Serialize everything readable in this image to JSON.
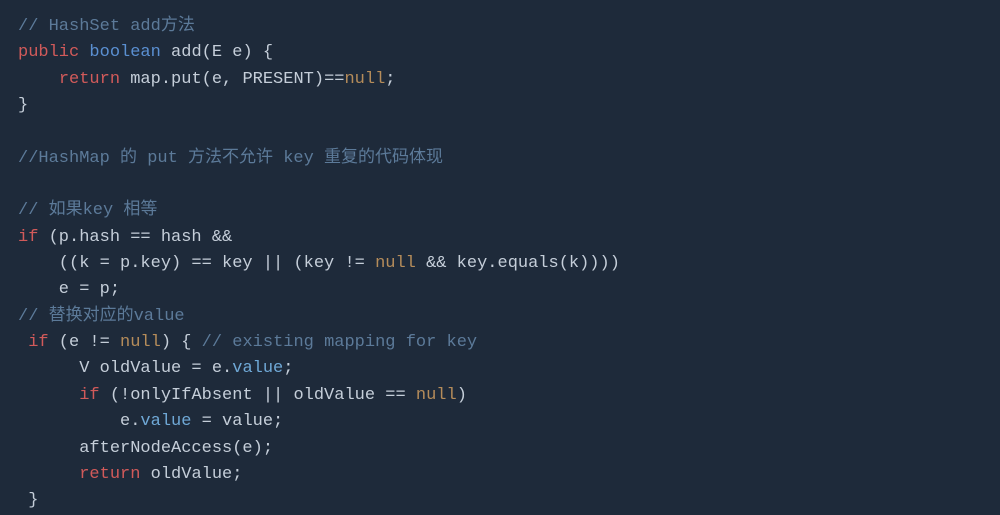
{
  "code": {
    "c1": "// HashSet add方法",
    "kw_public": "public",
    "kw_boolean": "boolean",
    "fn_add": " add(E e) {",
    "kw_return1": "return",
    "ln_return_body": " map.put(e, PRESENT)==",
    "null1": "null",
    "semi1": ";",
    "brace1": "}",
    "c2": "//HashMap 的 put 方法不允许 key 重复的代码体现",
    "c3": "// 如果key 相等",
    "kw_if1": "if",
    "ln_if1a": " (p.hash == hash &&",
    "ln_if1b": "    ((k = p.key) == key || (key != ",
    "null2": "null",
    "ln_if1b2": " && key.equals(k))))",
    "ln_ep": "    e = p;",
    "c4": "// 替换对应的value",
    "sp_if2_indent": " ",
    "kw_if2": "if",
    "ln_if2a": " (e != ",
    "null3": "null",
    "ln_if2b": ") { ",
    "c5": "// existing mapping for key",
    "ln_oldv": "      V oldValue = e.",
    "prop_value1": "value",
    "semi2": ";",
    "ind_if3": "      ",
    "kw_if3": "if",
    "ln_if3a": " (!onlyIfAbsent || oldValue == ",
    "null4": "null",
    "ln_if3b": ")",
    "ln_assign_pre": "          e.",
    "prop_value2": "value",
    "ln_assign_post": " = value;",
    "ln_after": "      afterNodeAccess(e);",
    "ind_ret2": "      ",
    "kw_return2": "return",
    "ln_ret2": " oldValue;",
    "brace2": " }"
  }
}
